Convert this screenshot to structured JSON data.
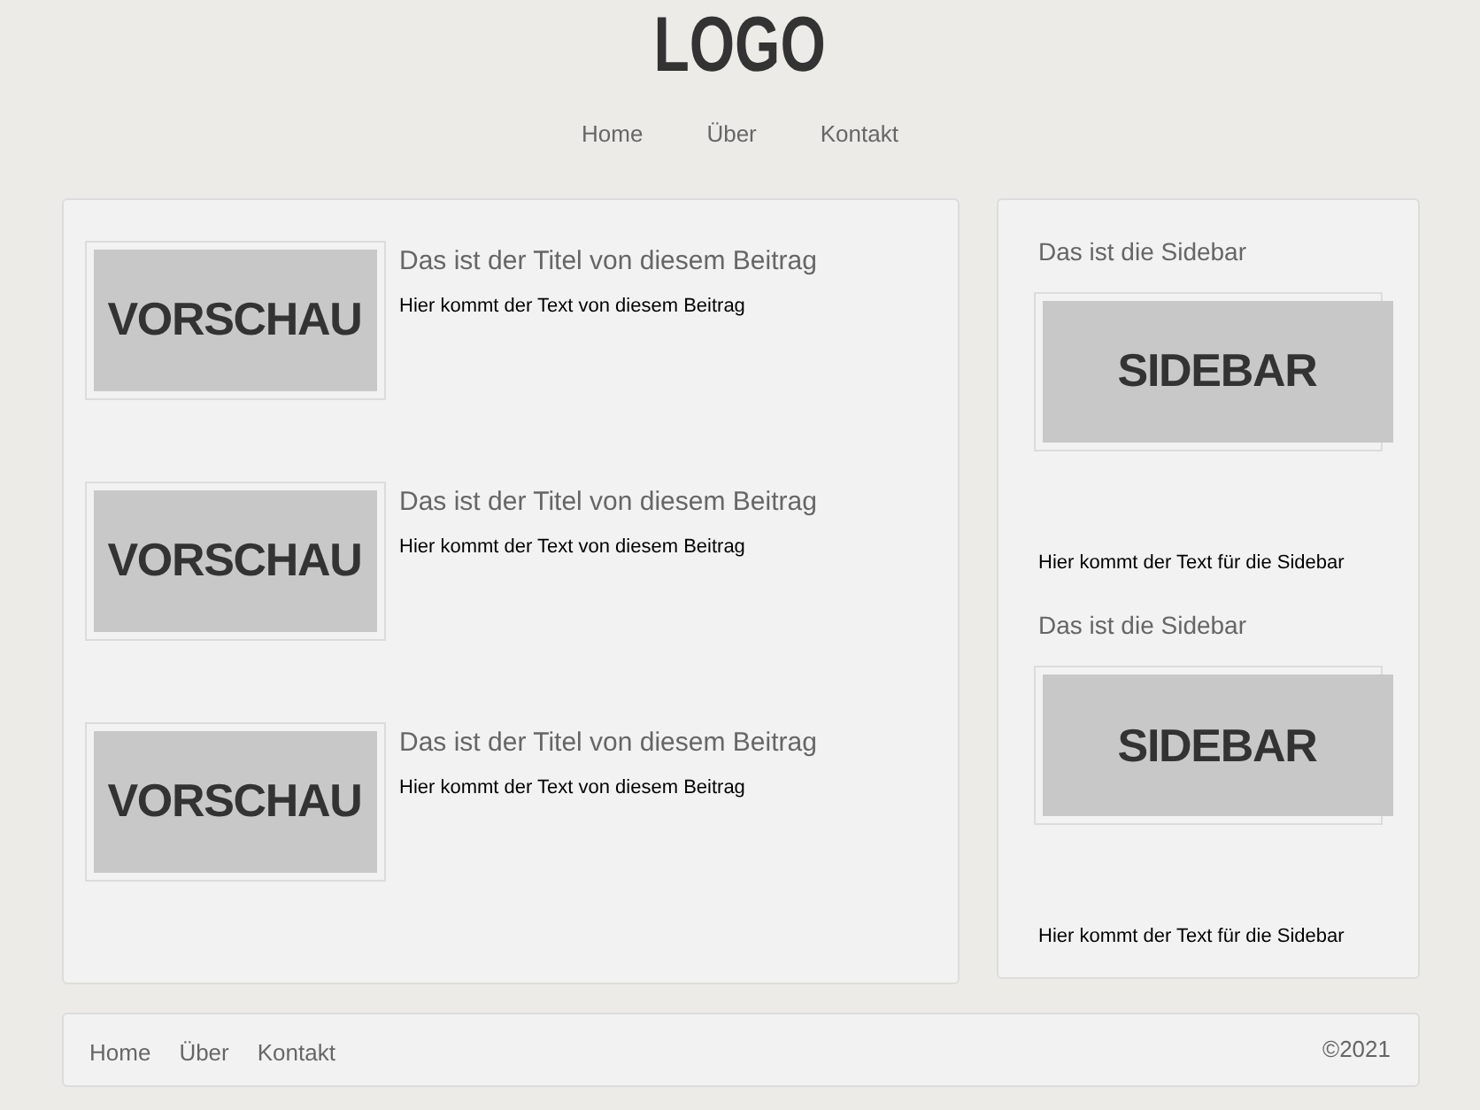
{
  "logo": "LOGO",
  "nav": [
    "Home",
    "Über",
    "Kontakt"
  ],
  "posts": [
    {
      "image_text": "VORSCHAU",
      "title": "Das ist der Titel von diesem Beitrag",
      "text": "Hier kommt der Text von diesem Beitrag"
    },
    {
      "image_text": "VORSCHAU",
      "title": "Das ist der Titel von diesem Beitrag",
      "text": "Hier kommt der Text von diesem Beitrag"
    },
    {
      "image_text": "VORSCHAU",
      "title": "Das ist der Titel von diesem Beitrag",
      "text": "Hier kommt der Text von diesem Beitrag"
    }
  ],
  "sidebar": [
    {
      "title": "Das ist die Sidebar",
      "image_text": "SIDEBAR",
      "text": "Hier kommt der Text für die Sidebar"
    },
    {
      "title": "Das ist die Sidebar",
      "image_text": "SIDEBAR",
      "text": "Hier kommt der Text für die Sidebar"
    }
  ],
  "footer": {
    "links": [
      "Home",
      "Über",
      "Kontakt"
    ],
    "copyright": "©2021"
  }
}
